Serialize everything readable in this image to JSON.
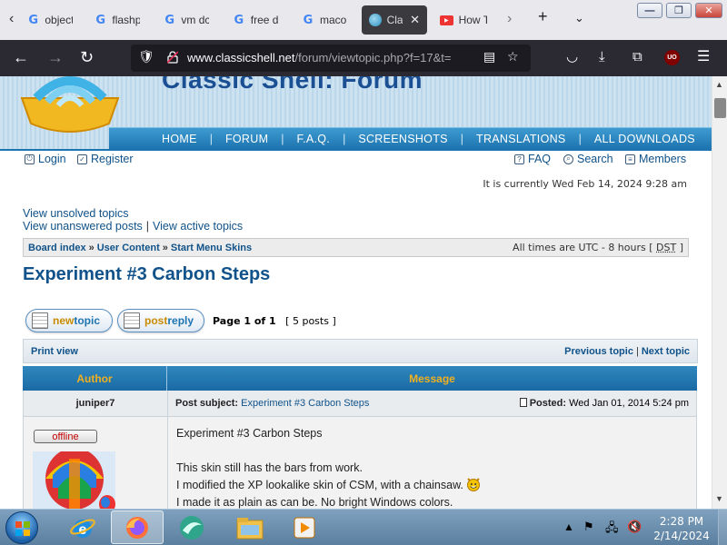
{
  "browser": {
    "tabs": [
      {
        "label": "object",
        "icon": "google-icon"
      },
      {
        "label": "flashp",
        "icon": "google-icon"
      },
      {
        "label": "vm dc",
        "icon": "google-icon"
      },
      {
        "label": "free d",
        "icon": "google-icon"
      },
      {
        "label": "maco",
        "icon": "google-icon"
      },
      {
        "label": "Cla",
        "icon": "classic-shell-icon",
        "active": true
      },
      {
        "label": "How T",
        "icon": "video-icon"
      }
    ],
    "url_host": "www.classicshell.net",
    "url_path": "/forum/viewtopic.php?f=17&t=",
    "ublock_label": "UO"
  },
  "site": {
    "banner_title": "Classic Shell: Forum",
    "menu": [
      "HOME",
      "FORUM",
      "F.A.Q.",
      "SCREENSHOTS",
      "TRANSLATIONS",
      "ALL DOWNLOADS"
    ],
    "login": "Login",
    "register": "Register",
    "faq": "FAQ",
    "search": "Search",
    "members": "Members",
    "current_time": "It is currently Wed Feb 14, 2024 9:28 am",
    "view_unsolved": "View unsolved topics",
    "view_unanswered": "View unanswered posts",
    "quick_sep": "|",
    "view_active": "View active topics",
    "crumbs": [
      "Board index",
      "User Content",
      "Start Menu Skins"
    ],
    "crumb_sep": "»",
    "tz_prefix": "All times are UTC - 8 hours [",
    "tz_dst": "DST",
    "tz_suffix": "]"
  },
  "topic": {
    "title": "Experiment #3 Carbon Steps",
    "new_topic_a": "new",
    "new_topic_b": "topic",
    "post_reply_a": "post",
    "post_reply_b": "reply",
    "page_info": "Page 1 of 1",
    "post_count": "[ 5 posts ]",
    "print_view": "Print view",
    "prev_topic": "Previous topic",
    "nav_sep": "|",
    "next_topic": "Next topic"
  },
  "post": {
    "col_author": "Author",
    "col_message": "Message",
    "author": "juniper7",
    "subject_label": "Post subject:",
    "subject": "Experiment #3 Carbon Steps",
    "posted_label": "Posted:",
    "posted": "Wed Jan 01, 2014 5:24 pm",
    "status": "offline",
    "body": [
      "Experiment #3 Carbon Steps",
      "",
      "This skin still has the bars from work.",
      "I modified the XP lookalike skin of CSM, with a chainsaw.",
      "I made it as plain as can be. No bright Windows colors."
    ]
  },
  "taskbar": {
    "items": [
      "internet-explorer-icon",
      "firefox-icon",
      "green-app-icon",
      "file-explorer-icon",
      "media-player-icon"
    ],
    "time": "2:28 PM",
    "date": "2/14/2024"
  },
  "colors": {
    "link": "#105289",
    "header_blue": "#1d74b0",
    "author_header": "#f0b020",
    "offline_red": "#c00000"
  }
}
